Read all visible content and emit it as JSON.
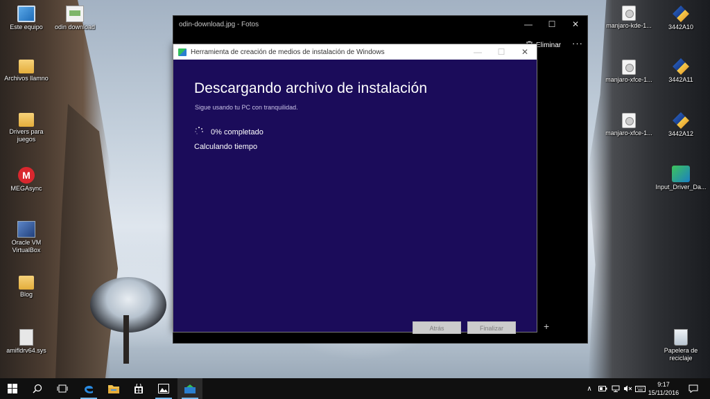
{
  "desktop": {
    "left_icons": [
      {
        "label": "Este equipo",
        "icon": "computer-icon"
      },
      {
        "label": "odin download",
        "icon": "image-file-icon"
      },
      {
        "label": "Archivos llamno",
        "icon": "folder-icon"
      },
      {
        "label": "Drivers para juegos",
        "icon": "folder-icon"
      },
      {
        "label": "MEGAsync",
        "icon": "mega-icon"
      },
      {
        "label": "Oracle VM VirtualBox",
        "icon": "virtualbox-icon"
      },
      {
        "label": "Blog",
        "icon": "folder-icon"
      },
      {
        "label": "amifldrv64.sys",
        "icon": "system-file-icon"
      }
    ],
    "right_icons": [
      {
        "label": "manjaro-kde-1...",
        "icon": "disc-image-icon"
      },
      {
        "label": "3442A10",
        "icon": "installer-icon"
      },
      {
        "label": "manjaro-xfce-1...",
        "icon": "disc-image-icon"
      },
      {
        "label": "3442A11",
        "icon": "installer-icon"
      },
      {
        "label": "manjaro-xfce-1...",
        "icon": "disc-image-icon"
      },
      {
        "label": "3442A12",
        "icon": "installer-icon"
      },
      {
        "label": "Input_Driver_Da...",
        "icon": "network-installer-icon"
      },
      {
        "label": "Papelera de reciclaje",
        "icon": "recycle-bin-icon"
      }
    ]
  },
  "photos_window": {
    "title": "odin-download.jpg - Fotos",
    "controls": {
      "minimize": "—",
      "maximize": "☐",
      "close": "✕"
    },
    "toolbar": {
      "delete_label": "Eliminar",
      "more_label": "···"
    },
    "bottom": {
      "zoom_out": "—",
      "zoom_in": "+"
    }
  },
  "mct_window": {
    "title": "Herramienta de creación de medios de instalación de Windows",
    "heading": "Descargando archivo de instalación",
    "subtitle": "Sigue usando tu PC con tranquilidad.",
    "progress_text": "0% completado",
    "progress_percent": 0,
    "time_text": "Calculando tiempo",
    "back_label": "Atrás",
    "finish_label": "Finalizar",
    "controls": {
      "minimize": "—",
      "maximize": "☐",
      "close": "✕"
    },
    "colors": {
      "background": "#1b0c5a",
      "button": "#cccccc"
    }
  },
  "taskbar": {
    "apps": [
      "start-icon",
      "search-icon",
      "task-view-icon",
      "edge-icon",
      "file-explorer-icon",
      "store-icon",
      "photos-icon",
      "media-creation-tool-icon"
    ],
    "tray": {
      "chevron": "∧",
      "notifications": "☐"
    },
    "clock": {
      "time": "9:17",
      "date": "15/11/2016"
    }
  }
}
